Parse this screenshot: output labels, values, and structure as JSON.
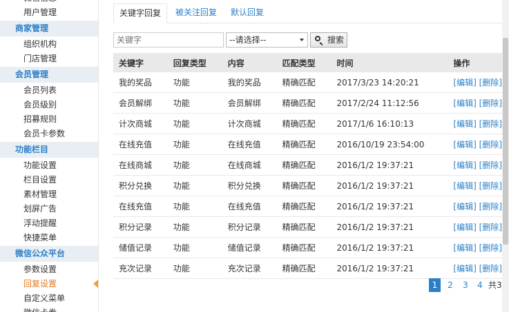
{
  "sidebar": {
    "top_partial": "微信信息",
    "groups": [
      {
        "title": null,
        "items": [
          "用户管理"
        ]
      },
      {
        "title": "商家管理",
        "items": [
          "组织机构",
          "门店管理"
        ]
      },
      {
        "title": "会员管理",
        "items": [
          "会员列表",
          "会员级别",
          "招募规则",
          "会员卡参数"
        ]
      },
      {
        "title": "功能栏目",
        "items": [
          "功能设置",
          "栏目设置",
          "素材管理",
          "划屏广告",
          "浮动提醒",
          "快捷菜单"
        ]
      },
      {
        "title": "微信公众平台",
        "items": [
          "参数设置",
          "回复设置",
          "自定义菜单",
          "微信卡券"
        ]
      }
    ],
    "active_item": "回复设置"
  },
  "tabs": [
    {
      "label": "关键字回复",
      "active": true
    },
    {
      "label": "被关注回复",
      "active": false
    },
    {
      "label": "默认回复",
      "active": false
    }
  ],
  "search": {
    "keyword_placeholder": "关键字",
    "select_value": "--请选择--",
    "button_label": "搜索"
  },
  "table": {
    "headers": [
      "关键字",
      "回复类型",
      "内容",
      "匹配类型",
      "时间",
      "操作"
    ],
    "edit_label": "[编辑]",
    "delete_label": "[删除]",
    "rows": [
      [
        "我的奖品",
        "功能",
        "我的奖品",
        "精确匹配",
        "2017/3/23 14:20:21"
      ],
      [
        "会员解绑",
        "功能",
        "会员解绑",
        "精确匹配",
        "2017/2/24 11:12:56"
      ],
      [
        "计次商城",
        "功能",
        "计次商城",
        "精确匹配",
        "2017/1/6 16:10:13"
      ],
      [
        "在线充值",
        "功能",
        "在线充值",
        "精确匹配",
        "2016/10/19 23:54:00"
      ],
      [
        "在线商城",
        "功能",
        "在线商城",
        "精确匹配",
        "2016/1/2 19:37:21"
      ],
      [
        "积分兑换",
        "功能",
        "积分兑换",
        "精确匹配",
        "2016/1/2 19:37:21"
      ],
      [
        "在线充值",
        "功能",
        "在线充值",
        "精确匹配",
        "2016/1/2 19:37:21"
      ],
      [
        "积分记录",
        "功能",
        "积分记录",
        "精确匹配",
        "2016/1/2 19:37:21"
      ],
      [
        "储值记录",
        "功能",
        "储值记录",
        "精确匹配",
        "2016/1/2 19:37:21"
      ],
      [
        "充次记录",
        "功能",
        "充次记录",
        "精确匹配",
        "2016/1/2 19:37:21"
      ]
    ]
  },
  "pager": {
    "pages": [
      "1",
      "2",
      "3",
      "4"
    ],
    "current": "1",
    "total_text": "共3"
  },
  "colors": {
    "accent": "#2b7fc8",
    "active_orange": "#e07a1f",
    "group_bg": "#e8eef3"
  }
}
